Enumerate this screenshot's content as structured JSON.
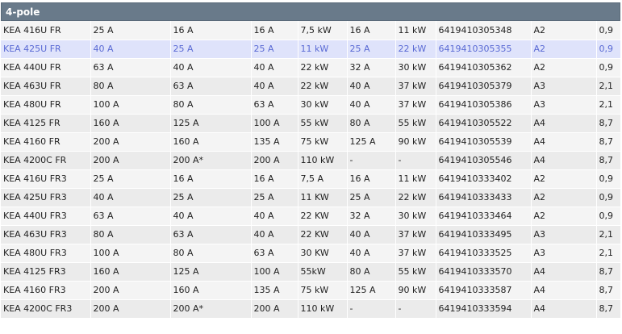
{
  "section": {
    "title": "4-pole"
  },
  "selected_row": 1,
  "rows": [
    [
      "KEA 416U FR",
      "25 A",
      "16 A",
      "16 A",
      "7,5 kW",
      "16 A",
      "11 kW",
      "6419410305348",
      "A2",
      "0,9"
    ],
    [
      "KEA 425U FR",
      "40 A",
      "25 A",
      "25 A",
      "11 kW",
      "25 A",
      "22 kW",
      "6419410305355",
      "A2",
      "0,9"
    ],
    [
      "KEA 440U FR",
      "63 A",
      "40 A",
      "40 A",
      "22 kW",
      "32 A",
      "30 kW",
      "6419410305362",
      "A2",
      "0,9"
    ],
    [
      "KEA 463U FR",
      "80 A",
      "63 A",
      "40 A",
      "22 kW",
      "40 A",
      "37 kW",
      "6419410305379",
      "A3",
      "2,1"
    ],
    [
      "KEA 480U FR",
      "100 A",
      "80 A",
      "63 A",
      "30 kW",
      "40 A",
      "37 kW",
      "6419410305386",
      "A3",
      "2,1"
    ],
    [
      "KEA 4125 FR",
      "160 A",
      "125 A",
      "100 A",
      "55 kW",
      "80 A",
      "55 kW",
      "6419410305522",
      "A4",
      "8,7"
    ],
    [
      "KEA 4160 FR",
      "200 A",
      "160 A",
      "135 A",
      "75 kW",
      "125 A",
      "90 kW",
      "6419410305539",
      "A4",
      "8,7"
    ],
    [
      "KEA 4200C FR",
      "200 A",
      "200 A*",
      "200 A",
      "110 kW",
      "-",
      "-",
      "6419410305546",
      "A4",
      "8,7"
    ],
    [
      "KEA 416U FR3",
      "25 A",
      "16 A",
      "16 A",
      "7,5 A",
      "16 A",
      "11 kW",
      "6419410333402",
      "A2",
      "0,9"
    ],
    [
      "KEA 425U FR3",
      "40 A",
      "25 A",
      "25 A",
      "11 KW",
      "25 A",
      "22 kW",
      "6419410333433",
      "A2",
      "0,9"
    ],
    [
      "KEA 440U FR3",
      "63 A",
      "40 A",
      "40 A",
      "22 KW",
      "32 A",
      "30 kW",
      "6419410333464",
      "A2",
      "0,9"
    ],
    [
      "KEA 463U FR3",
      "80 A",
      "63 A",
      "40 A",
      "22 KW",
      "40 A",
      "37 kW",
      "6419410333495",
      "A3",
      "2,1"
    ],
    [
      "KEA 480U FR3",
      "100 A",
      "80 A",
      "63 A",
      "30 KW",
      "40 A",
      "37 kW",
      "6419410333525",
      "A3",
      "2,1"
    ],
    [
      "KEA 4125 FR3",
      "160 A",
      "125 A",
      "100 A",
      "55kW",
      "80 A",
      "55 kW",
      "6419410333570",
      "A4",
      "8,7"
    ],
    [
      "KEA 4160 FR3",
      "200 A",
      "160 A",
      "135 A",
      "75 kW",
      "125 A",
      "90 kW",
      "6419410333587",
      "A4",
      "8,7"
    ],
    [
      "KEA 4200C FR3",
      "200 A",
      "200 A*",
      "200 A",
      "110 kW",
      "-",
      "-",
      "6419410333594",
      "A4",
      "8,7"
    ]
  ]
}
